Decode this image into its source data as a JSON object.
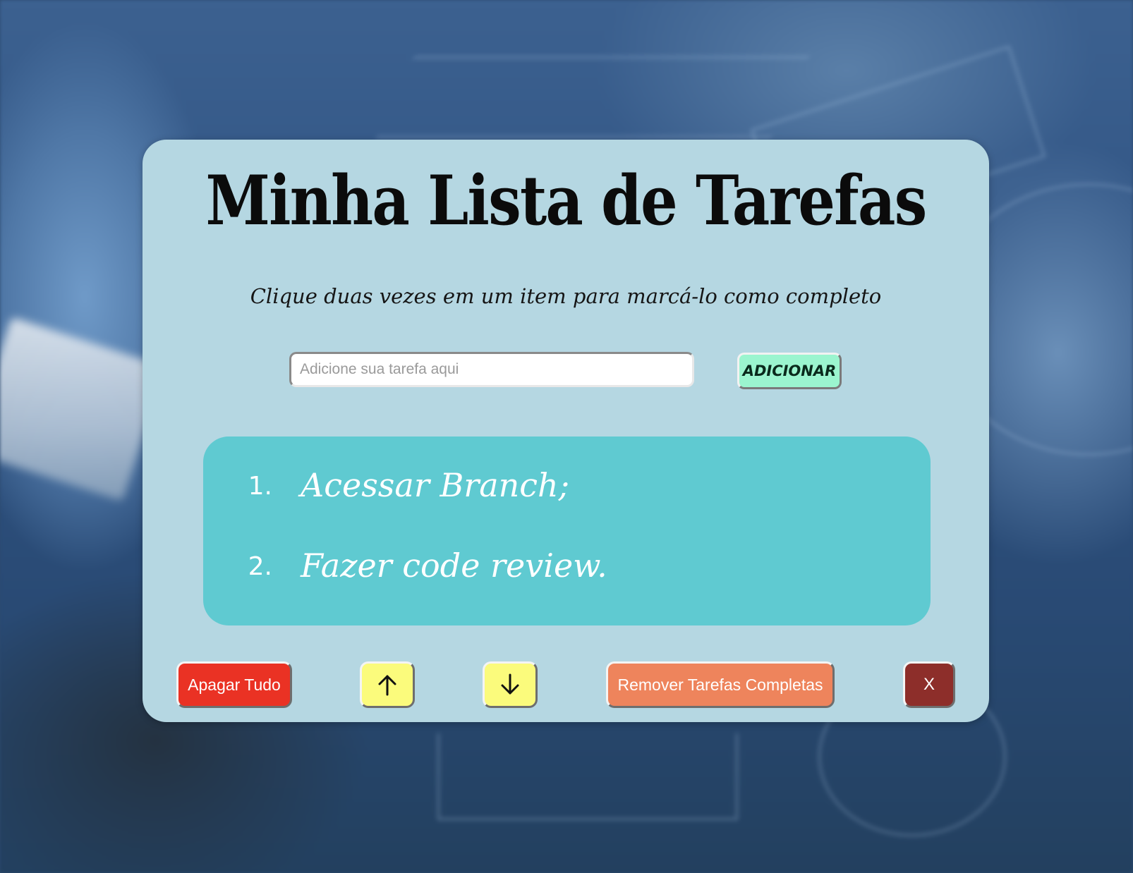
{
  "page": {
    "title": "Minha Lista de Tarefas",
    "subtitle": "Clique duas vezes em um item para marcá-lo como completo"
  },
  "form": {
    "input_placeholder": "Adicione sua tarefa aqui",
    "input_value": "",
    "add_label": "ADICIONAR"
  },
  "tasks": [
    {
      "number": "1.",
      "text": "Acessar Branch;"
    },
    {
      "number": "2.",
      "text": "Fazer code review."
    }
  ],
  "controls": {
    "clear_all_label": "Apagar Tudo",
    "move_up_icon": "arrow-up-icon",
    "move_down_icon": "arrow-down-icon",
    "remove_completed_label": "Remover Tarefas Completas",
    "close_label": "X"
  },
  "colors": {
    "card": "#b5d7e2",
    "list_box": "#5fcad1",
    "add_button": "#9bf5cf",
    "clear_button": "#ea3224",
    "arrow_buttons": "#fbfb7c",
    "remove_completed_button": "#ee845c",
    "close_button": "#8d2e2a"
  }
}
